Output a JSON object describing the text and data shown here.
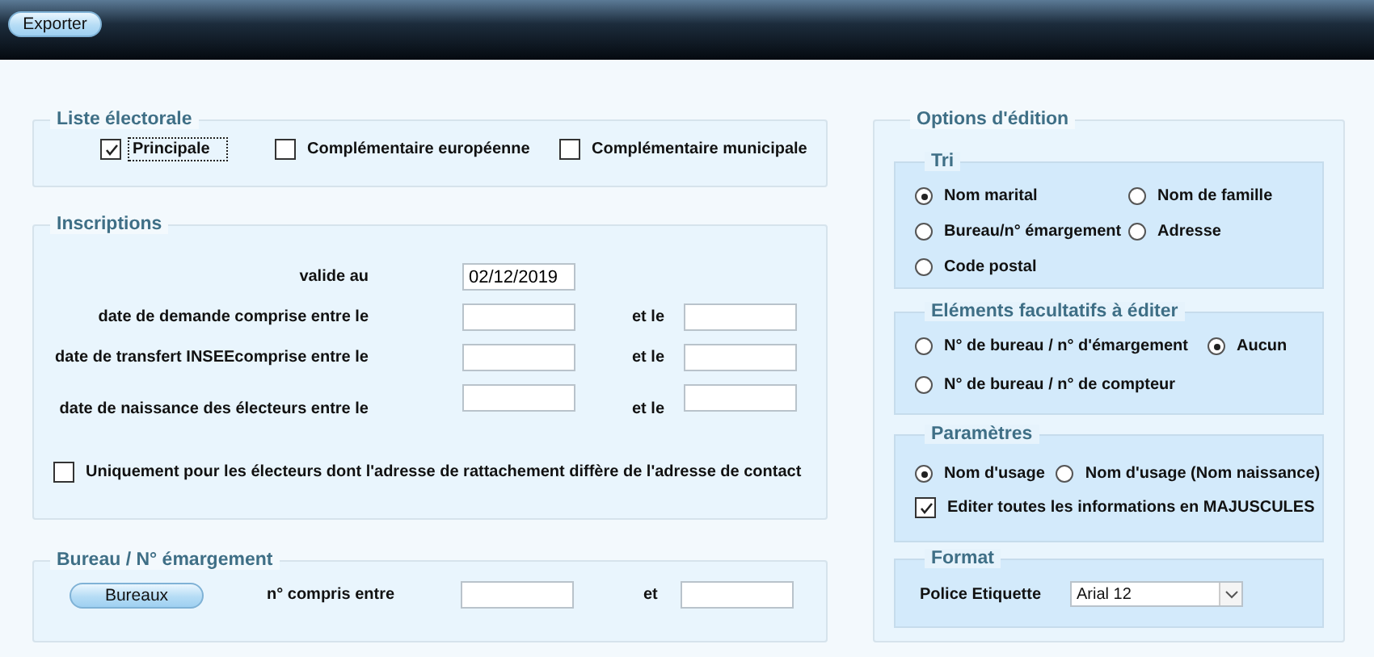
{
  "toolbar": {
    "buttons": [
      {
        "label": "Exporter"
      }
    ]
  },
  "liste_electorale": {
    "title": "Liste électorale",
    "options": [
      {
        "label": "Principale",
        "checked": true,
        "focused": true
      },
      {
        "label": "Complémentaire européenne",
        "checked": false,
        "focused": false
      },
      {
        "label": "Complémentaire municipale",
        "checked": false,
        "focused": false
      }
    ]
  },
  "inscriptions": {
    "title": "Inscriptions",
    "valid_at": {
      "label": "valide au",
      "value": "02/12/2019"
    },
    "ranges": [
      {
        "label": "date de demande comprise entre le",
        "to_label": "et le"
      },
      {
        "label": "date de transfert INSEEcomprise entre le",
        "to_label": "et le"
      },
      {
        "label": "date de naissance des électeurs entre le",
        "to_label": "et le"
      }
    ],
    "address_filter": {
      "label": "Uniquement pour les électeurs dont l'adresse de rattachement diffère de l'adresse de contact",
      "checked": false
    }
  },
  "bureau": {
    "title": "Bureau / N° émargement",
    "button": "Bureaux",
    "label": "n° compris entre",
    "to_label": "et"
  },
  "options": {
    "title": "Options d'édition",
    "tri": {
      "title": "Tri",
      "options": [
        {
          "label": "Nom marital",
          "selected": true
        },
        {
          "label": "Nom de famille",
          "selected": false
        },
        {
          "label": "Bureau/n° émargement",
          "selected": false
        },
        {
          "label": "Adresse",
          "selected": false
        },
        {
          "label": "Code postal",
          "selected": false
        }
      ]
    },
    "elements": {
      "title": "Eléments facultatifs à éditer",
      "options": [
        {
          "label": "N° de bureau / n° d'émargement",
          "selected": false
        },
        {
          "label": "Aucun",
          "selected": true
        },
        {
          "label": "N° de bureau / n° de compteur",
          "selected": false
        }
      ]
    },
    "parametres": {
      "title": "Paramètres",
      "options": [
        {
          "label": "Nom d'usage",
          "selected": true
        },
        {
          "label": "Nom d'usage (Nom naissance)",
          "selected": false
        }
      ],
      "uppercase": {
        "label": "Editer toutes les informations en MAJUSCULES",
        "checked": true
      }
    },
    "format": {
      "title": "Format",
      "label": "Police Etiquette",
      "value": "Arial 12"
    }
  }
}
